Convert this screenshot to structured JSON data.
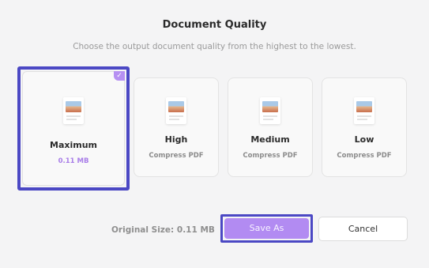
{
  "dialog": {
    "title": "Document Quality",
    "subtitle": "Choose the output document quality from the highest to the lowest."
  },
  "options": [
    {
      "label": "Maximum",
      "detail": "0.11 MB",
      "selected": true
    },
    {
      "label": "High",
      "detail": "Compress PDF",
      "selected": false
    },
    {
      "label": "Medium",
      "detail": "Compress PDF",
      "selected": false
    },
    {
      "label": "Low",
      "detail": "Compress PDF",
      "selected": false
    }
  ],
  "footer": {
    "original_size": "Original Size: 0.11 MB",
    "save_label": "Save As",
    "cancel_label": "Cancel"
  },
  "colors": {
    "accent": "#b28bf2",
    "focus_outline": "#4b48c4",
    "selected_size_text": "#a97ee8"
  },
  "icons": {
    "option_thumbnail": "document-image-icon",
    "selected_mark": "checkmark-icon"
  }
}
